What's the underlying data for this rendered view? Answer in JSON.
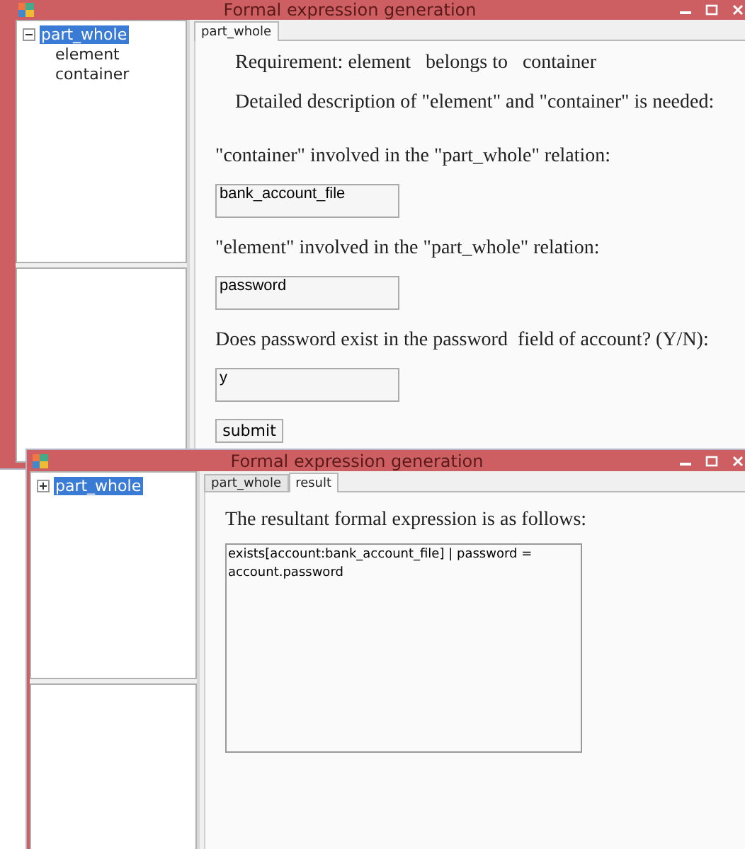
{
  "windows": [
    {
      "title": "Formal expression generation",
      "tree": [
        {
          "label": "part_whole",
          "selected": true,
          "expanded": true,
          "children": [
            {
              "label": "element",
              "selected": false
            },
            {
              "label": "container",
              "selected": false
            }
          ]
        }
      ],
      "tabs": [
        {
          "label": "part_whole",
          "selected": true
        }
      ],
      "content": {
        "kind": "form",
        "lines": [
          "Requirement: element   belongs to   container",
          "Detailed description of \"element\" and \"container\" is needed:"
        ],
        "fields": [
          {
            "label": "\"container\" involved in the \"part_whole\" relation:",
            "value": "bank_account_file"
          },
          {
            "label": "\"element\" involved in the \"part_whole\" relation:",
            "value": "password"
          },
          {
            "label": "Does password exist in the password  field of account? (Y/N):",
            "value": "y"
          }
        ],
        "button": "submit"
      }
    },
    {
      "title": "Formal expression generation",
      "tree": [
        {
          "label": "part_whole",
          "selected": true,
          "expanded": false
        }
      ],
      "tabs": [
        {
          "label": "part_whole",
          "selected": false
        },
        {
          "label": "result",
          "selected": true
        }
      ],
      "content": {
        "kind": "result",
        "heading": "The resultant formal expression is as follows:",
        "output": "exists[account:bank_account_file] | password = account.password"
      }
    }
  ]
}
